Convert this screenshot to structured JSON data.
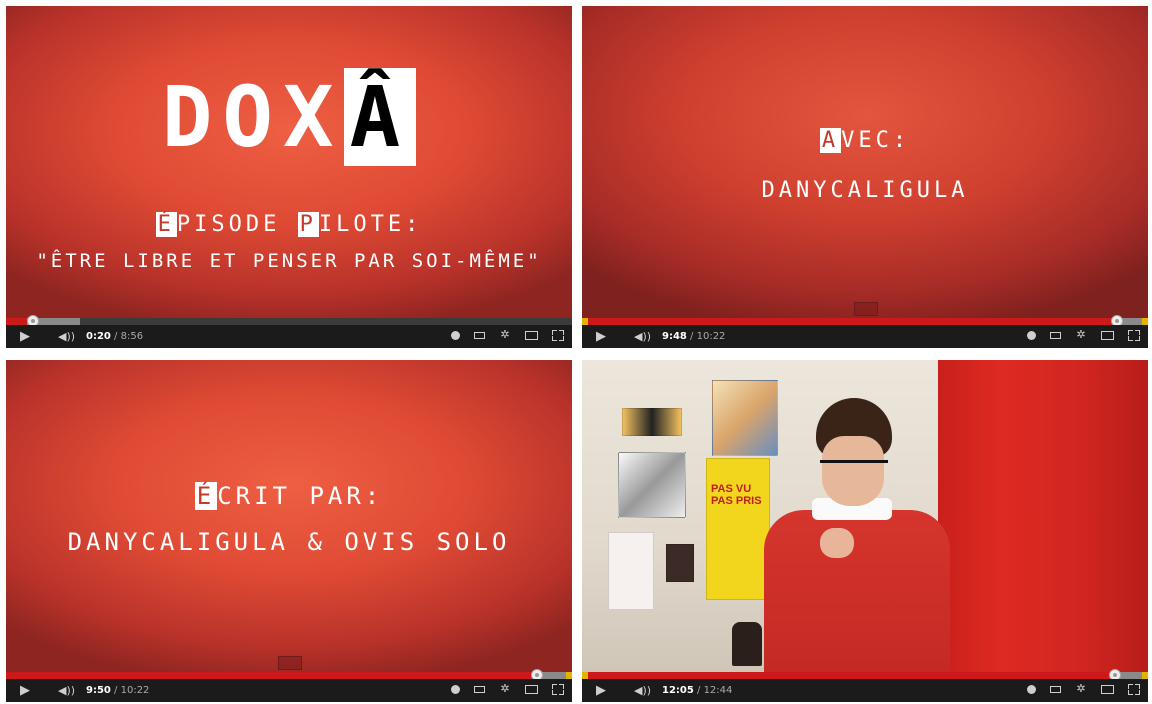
{
  "panels": [
    {
      "title_main": "DOX",
      "title_inv": "Â",
      "line1_box": "É",
      "line1_rest": "PISODE ",
      "line1_box2": "P",
      "line1_rest2": "ILOTE:",
      "line2": "\"ÊTRE LIBRE ET PENSER PAR SOI-MÊME\"",
      "time_current": "0:20",
      "time_total": " / 8:56",
      "progress_fraction": 0.037
    },
    {
      "line1_box": "A",
      "line1_rest": "VEC:",
      "line2": "DANYCALIGULA",
      "time_current": "9:48",
      "time_total": " / 10:22",
      "progress_fraction": 0.945
    },
    {
      "line1_box": "É",
      "line1_rest": "CRIT PAR:",
      "line2": "DANYCALIGULA & OVIS SOLO",
      "time_current": "9:50",
      "time_total": " / 10:22",
      "progress_fraction": 0.948
    },
    {
      "poster_text": "PAS VU PAS PRIS",
      "time_current": "12:05",
      "time_total": " / 12:44",
      "progress_fraction": 0.949
    }
  ],
  "icons": {
    "play": "▶",
    "volume": "◀))",
    "settings": "✲"
  },
  "colors": {
    "progress_played": "#cc1a1a",
    "progress_marker": "#e0b400",
    "background_red": "#df4a34"
  }
}
